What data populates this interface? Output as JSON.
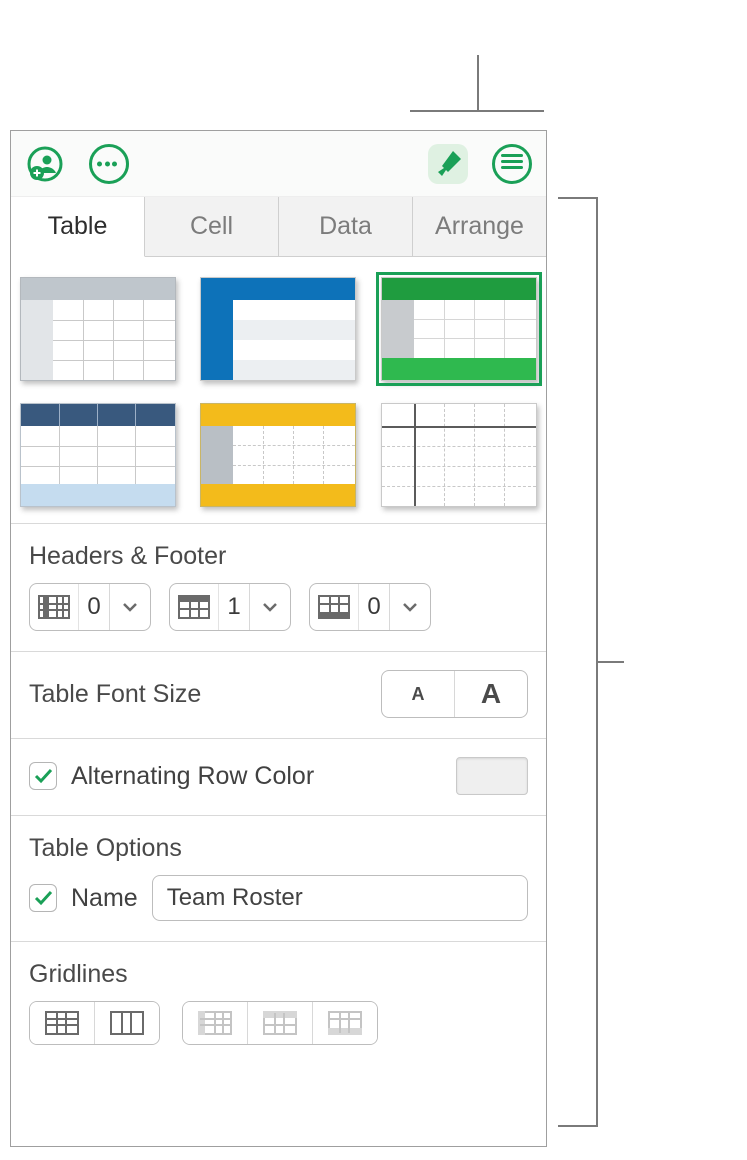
{
  "toolbar": {
    "add_collaborator": "add-collaborator",
    "more": "more-options",
    "format": "format-paintbrush",
    "view": "view-options"
  },
  "tabs": [
    "Table",
    "Cell",
    "Data",
    "Arrange"
  ],
  "active_tab": 0,
  "styles": {
    "selected_index": 2
  },
  "headers_footer": {
    "title": "Headers & Footer",
    "header_cols": "0",
    "header_rows": "1",
    "footer_rows": "0"
  },
  "font_size": {
    "title": "Table Font Size",
    "small": "A",
    "big": "A"
  },
  "alt_row": {
    "label": "Alternating Row Color",
    "checked": true,
    "color": "#efefef"
  },
  "table_options": {
    "title": "Table Options",
    "name_label": "Name",
    "name_checked": true,
    "name_value": "Team Roster"
  },
  "gridlines": {
    "title": "Gridlines"
  }
}
